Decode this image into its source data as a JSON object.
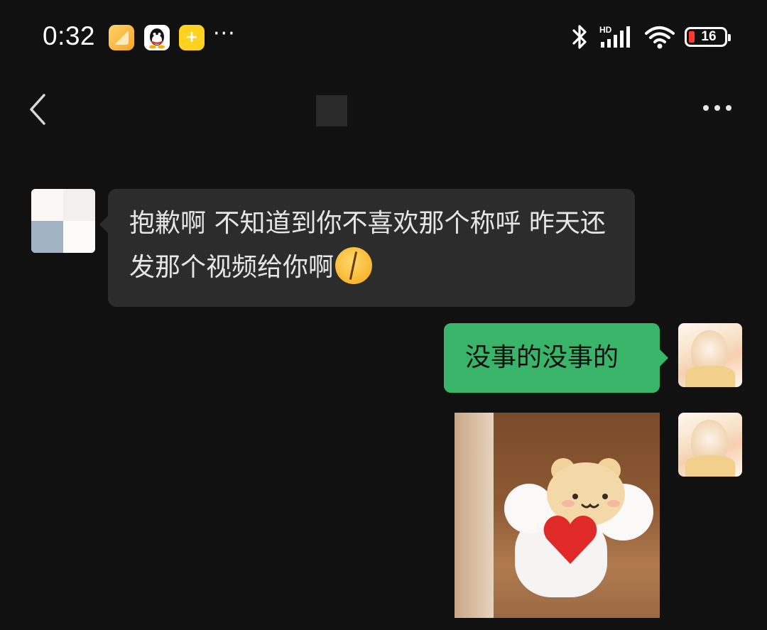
{
  "status_bar": {
    "time": "0:32",
    "notification_icons": [
      "notes-icon",
      "qq-icon",
      "wallet-icon"
    ],
    "overflow": "···",
    "network_label": "HD",
    "battery_percent": "16",
    "battery_level": 16
  },
  "nav": {
    "back_icon": "chevron-left-icon",
    "title": "",
    "menu_icon": "more-icon"
  },
  "messages": [
    {
      "side": "incoming",
      "text": "抱歉啊 不知道到你不喜欢那个称呼  昨天还发那个视频给你啊",
      "emoji": "zipper-mouth-face"
    },
    {
      "side": "outgoing",
      "text": "没事的没事的"
    },
    {
      "side": "outgoing",
      "type": "sticker",
      "sticker": "hamster-with-heart"
    }
  ],
  "colors": {
    "background": "#111111",
    "incoming_bubble": "#2c2c2c",
    "outgoing_bubble": "#39b56a"
  }
}
